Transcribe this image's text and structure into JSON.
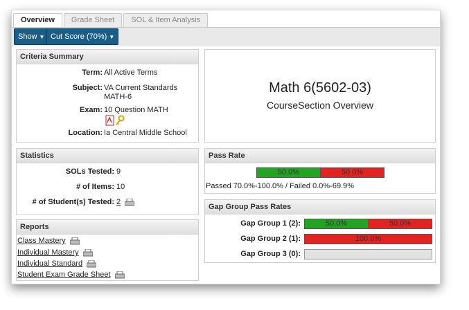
{
  "tabs": [
    "Overview",
    "Grade Sheet",
    "SOL & Item Analysis"
  ],
  "toolbar": {
    "show_label": "Show",
    "cut_score_label": "Cut Score (70%)"
  },
  "criteria": {
    "header": "Criteria Summary",
    "term_label": "Term:",
    "term_value": "All Active Terms",
    "subject_label": "Subject:",
    "subject_value_1": "VA Current Standards",
    "subject_value_2": "MATH-6",
    "exam_label": "Exam:",
    "exam_value": "10 Question MATH",
    "location_label": "Location:",
    "location_value": "Ia Central Middle School"
  },
  "course": {
    "title": "Math 6(5602-03)",
    "subtitle": "CourseSection Overview"
  },
  "statistics": {
    "header": "Statistics",
    "sols_label": "SOLs Tested:",
    "sols_value": "9",
    "items_label": "# of Items:",
    "items_value": "10",
    "students_label": "# of Student(s) Tested:",
    "students_value": "2"
  },
  "pass_rate": {
    "header": "Pass Rate",
    "pass_pct": 50.0,
    "fail_pct": 50.0,
    "pass_text": "50.0%",
    "fail_text": "50.0%",
    "range_text": "Passed 70.0%-100.0% / Failed 0.0%-69.9%"
  },
  "gap_groups": {
    "header": "Gap Group Pass Rates",
    "g1_label": "Gap Group 1 (2):",
    "g1_pass": 50.0,
    "g1_fail": 50.0,
    "g1_pass_text": "50.0%",
    "g1_fail_text": "50.0%",
    "g2_label": "Gap Group 2 (1):",
    "g2_fail": 100.0,
    "g2_fail_text": "100.0%",
    "g3_label": "Gap Group 3 (0):"
  },
  "reports": {
    "header": "Reports",
    "items": [
      "Class Mastery",
      "Individual Mastery",
      "Individual Standard",
      "Student Exam Grade Sheet"
    ]
  },
  "colors": {
    "pass": "#22a322",
    "fail": "#e32322",
    "button": "#1a5d86",
    "empty": "#e2e2e2"
  },
  "icons": [
    "pdf-icon",
    "key-icon",
    "printer-icon"
  ]
}
